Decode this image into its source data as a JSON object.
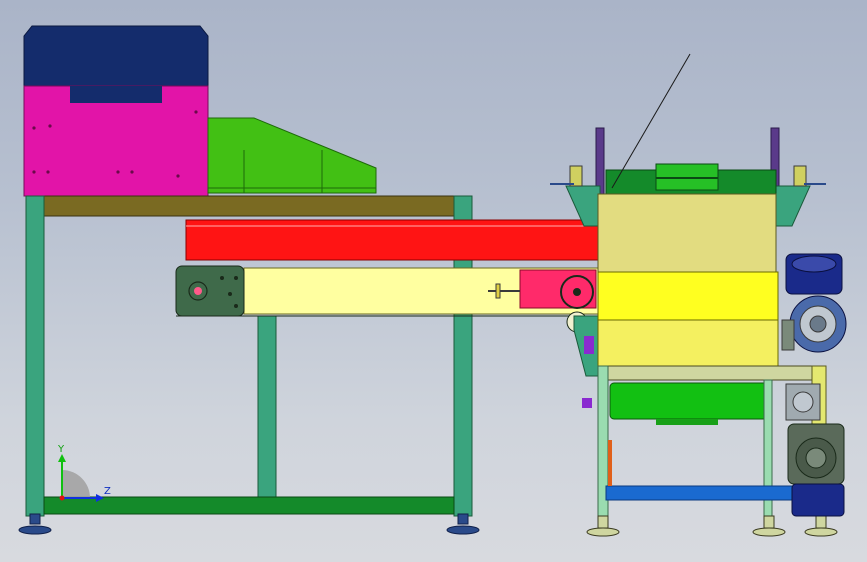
{
  "triad": {
    "y_label": "Y",
    "z_label": "Z"
  },
  "colors": {
    "hopper_top": "#142c6c",
    "hopper_body": "#e214a8",
    "chute": "#42c014",
    "frame_left": "#3aa47e",
    "beam_top": "#7a6a22",
    "red_tube": "#ff1414",
    "conveyor_yellow": "#ffffa0",
    "conveyor_endcap": "#3f6a4a",
    "pink_block": "#ff2a6a",
    "box_upper": "#e2dc80",
    "box_lower": "#ffff20",
    "roller_green": "#12c012",
    "motor_blue": "#1a2a8a",
    "motor_grey": "#5a6a5a",
    "blue_bar": "#1a6ad0"
  }
}
